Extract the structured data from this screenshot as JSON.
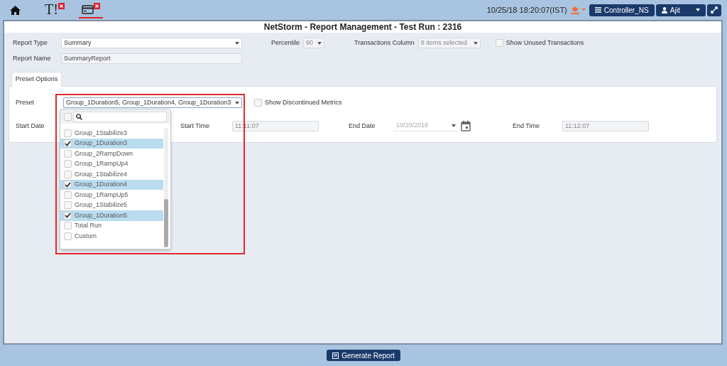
{
  "toolbar": {
    "tabs": [
      {
        "kind": "text",
        "label": "T!",
        "selected": false
      },
      {
        "kind": "card",
        "selected": true
      }
    ],
    "datetime": "10/25/18 18:20:07(IST)",
    "controller": "Controller_NS",
    "user": "Ajit"
  },
  "title": "NetStorm - Report Management - Test Run : 2316",
  "report_type": {
    "label": "Report Type",
    "value": "Summary"
  },
  "percentile": {
    "label": "Percentile",
    "value": "90"
  },
  "transactions_column": {
    "label": "Transactions Column",
    "value": "8 items selected"
  },
  "show_unused": {
    "label": "Show Unused Transactions",
    "checked": false
  },
  "report_name": {
    "label": "Report Name",
    "value": "SummaryReport"
  },
  "preset_tab": "Preset Options",
  "preset": {
    "label": "Preset",
    "value": "Group_1Duration5, Group_1Duration4, Group_1Duration3"
  },
  "show_discontinued": {
    "label": "Show Discontinued Metrics",
    "checked": false
  },
  "start_date": {
    "label": "Start Date"
  },
  "start_time": {
    "label": "Start Time",
    "value": "11:11:07"
  },
  "end_date": {
    "label": "End Date",
    "value": "10/20/2018"
  },
  "end_time": {
    "label": "End Time",
    "value": "11:12:07"
  },
  "dropdown": {
    "select_all_checked": false,
    "items": [
      {
        "label": "Group_1Stabilize3",
        "checked": false
      },
      {
        "label": "Group_1Duration3",
        "checked": true
      },
      {
        "label": "Group_2RampDown",
        "checked": false
      },
      {
        "label": "Group_1RampUp4",
        "checked": false
      },
      {
        "label": "Group_1Stabilize4",
        "checked": false
      },
      {
        "label": "Group_1Duration4",
        "checked": true
      },
      {
        "label": "Group_1RampUp5",
        "checked": false
      },
      {
        "label": "Group_1Stabilize5",
        "checked": false
      },
      {
        "label": "Group_1Duration5",
        "checked": true
      },
      {
        "label": "Total Run",
        "checked": false
      },
      {
        "label": "Custom",
        "checked": false
      }
    ]
  },
  "generate_button": "Generate Report"
}
